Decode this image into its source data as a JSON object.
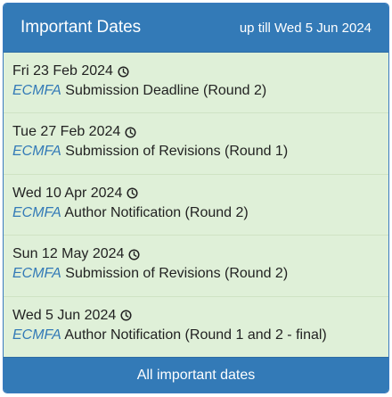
{
  "header": {
    "title": "Important Dates",
    "range": "up till Wed 5 Jun 2024"
  },
  "items": [
    {
      "date": "Fri 23 Feb 2024",
      "conference": "ECMFA",
      "description": "Submission Deadline (Round 2)",
      "icon": "clock-icon"
    },
    {
      "date": "Tue 27 Feb 2024",
      "conference": "ECMFA",
      "description": "Submission of Revisions (Round 1)",
      "icon": "clock-icon"
    },
    {
      "date": "Wed 10 Apr 2024",
      "conference": "ECMFA",
      "description": "Author Notification (Round 2)",
      "icon": "clock-icon"
    },
    {
      "date": "Sun 12 May 2024",
      "conference": "ECMFA",
      "description": "Submission of Revisions (Round 2)",
      "icon": "clock-icon"
    },
    {
      "date": "Wed 5 Jun 2024",
      "conference": "ECMFA",
      "description": "Author Notification (Round 1 and 2 - final)",
      "icon": "clock-icon"
    }
  ],
  "footer": {
    "label": "All important dates"
  },
  "colors": {
    "header_bg": "#337ab7",
    "body_bg": "#dff0d8",
    "link": "#337ab7"
  }
}
